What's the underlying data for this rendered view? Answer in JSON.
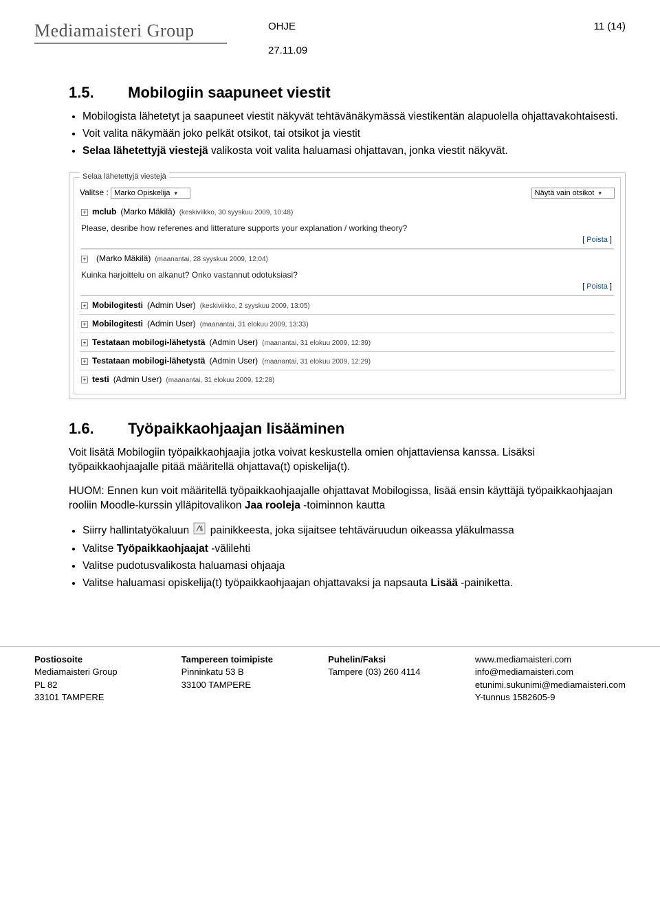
{
  "header": {
    "logo": "Mediamaisteri Group",
    "doc_type": "OHJE",
    "page_counter": "11 (14)",
    "date": "27.11.09"
  },
  "section15": {
    "num": "1.5.",
    "title": "Mobilogiin saapuneet viestit",
    "bullets": [
      "Mobilogista lähetetyt ja saapuneet viestit näkyvät tehtävänäkymässä viestikentän alapuolella ohjattavakohtaisesti.",
      "Voit valita näkymään joko pelkät otsikot, tai otsikot ja viestit",
      "Selaa lähetettyjä viestejä valikosta voit valita haluamasi ohjattavan, jonka viestit näkyvät."
    ],
    "bullets_bold": "Selaa lähetettyjä viestejä"
  },
  "screenshot": {
    "legend": "Selaa lähetettyjä viestejä",
    "valitse_label": "Valitse :",
    "valitse_value": "Marko Opiskelija",
    "nayta_value": "Näytä vain otsikot",
    "poista_label": "Poista",
    "messages": [
      {
        "subject": "mclub",
        "user": "(Marko Mäkilä)",
        "meta": "(keskiviikko, 30 syyskuu 2009, 10:48)",
        "body": "Please, desribe how referenes and litterature supports your explanation / working theory?",
        "show_poista": true
      },
      {
        "subject": "",
        "user": "(Marko Mäkilä)",
        "meta": "(maanantai, 28 syyskuu 2009, 12:04)",
        "body": "Kuinka harjoittelu on alkanut? Onko vastannut odotuksiasi?",
        "show_poista": true
      },
      {
        "subject": "Mobilogitesti",
        "user": "(Admin User)",
        "meta": "(keskiviikko, 2 syyskuu 2009, 13:05)"
      },
      {
        "subject": "Mobilogitesti",
        "user": "(Admin User)",
        "meta": "(maanantai, 31 elokuu 2009, 13:33)"
      },
      {
        "subject": "Testataan mobilogi-lähetystä",
        "user": "(Admin User)",
        "meta": "(maanantai, 31 elokuu 2009, 12:39)"
      },
      {
        "subject": "Testataan mobilogi-lähetystä",
        "user": "(Admin User)",
        "meta": "(maanantai, 31 elokuu 2009, 12:29)"
      },
      {
        "subject": "testi",
        "user": "(Admin User)",
        "meta": "(maanantai, 31 elokuu 2009, 12:28)"
      }
    ]
  },
  "section16": {
    "num": "1.6.",
    "title": "Työpaikkaohjaajan lisääminen",
    "para1": "Voit lisätä Mobilogiin työpaikkaohjaajia jotka voivat keskustella omien ohjattaviensa kanssa. Lisäksi työpaikkaohjaajalle pitää määritellä ohjattava(t) opiskelija(t).",
    "para2_pre": "HUOM: Ennen kun voit määritellä työpaikkaohjaajalle ohjattavat Mobilogissa, lisää ensin käyttäjä työpaikkaohjaajan rooliin Moodle-kurssin ylläpitovalikon ",
    "para2_bold": "Jaa rooleja",
    "para2_post": " -toiminnon kautta",
    "b1_pre": "Siirry hallintatyökaluun ",
    "b1_post": " painikkeesta, joka sijaitsee tehtäväruudun oikeassa yläkulmassa",
    "b2_pre": "Valitse ",
    "b2_bold": "Työpaikkaohjaajat",
    "b2_post": " -välilehti",
    "b3": "Valitse pudotusvalikosta haluamasi ohjaaja",
    "b4_pre": "Valitse haluamasi opiskelija(t) työpaikkaohjaajan ohjattavaksi ja napsauta ",
    "b4_bold": "Lisää",
    "b4_post": " -painiketta."
  },
  "footer": {
    "col1": {
      "h": "Postiosoite",
      "l1": "Mediamaisteri Group",
      "l2": "PL 82",
      "l3": "33101 TAMPERE"
    },
    "col2": {
      "h": "Tampereen toimipiste",
      "l1": "Pinninkatu  53 B",
      "l2": "33100 TAMPERE"
    },
    "col3": {
      "h": "Puhelin/Faksi",
      "l1": "Tampere (03) 260 4114"
    },
    "col4": {
      "l1": "www.mediamaisteri.com",
      "l2": "info@mediamaisteri.com",
      "l3": "etunimi.sukunimi@mediamaisteri.com",
      "l4": "Y-tunnus 1582605-9"
    }
  }
}
